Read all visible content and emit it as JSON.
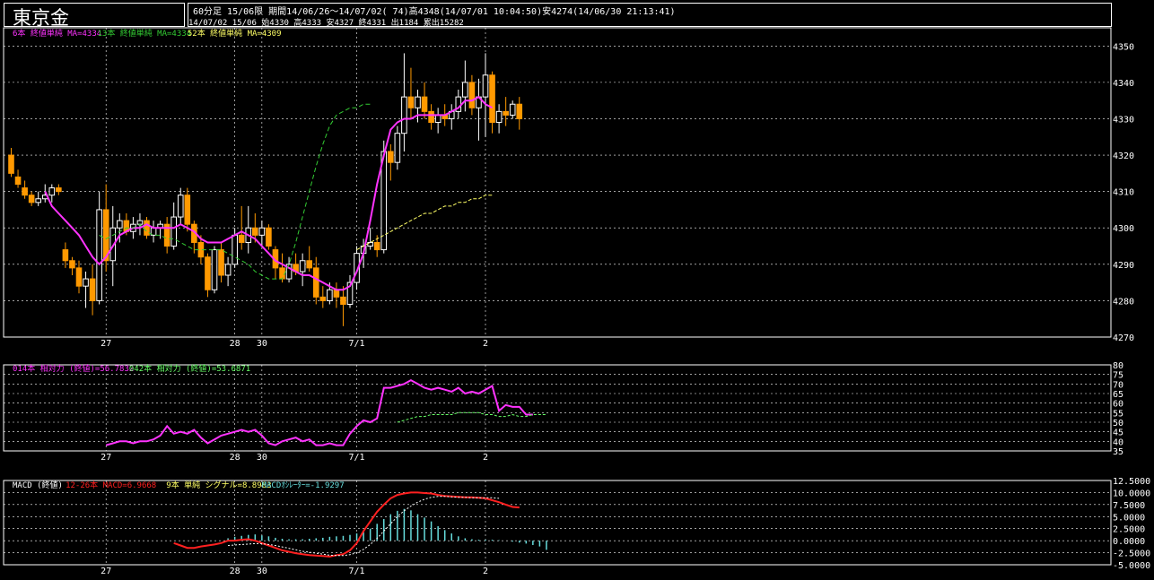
{
  "header": {
    "title": "東京金",
    "line1": "60分足 15/06限 期間14/06/26～14/07/02( 74)高4348(14/07/01 10:04:50)安4274(14/06/30 21:13:41)",
    "line2": "14/07/02 15/06 始4330 高4333 安4327 終4331 出1184 累出15282"
  },
  "colors": {
    "bg": "#000000",
    "grid": "#ffffff",
    "candle_up": "#ffffff",
    "candle_down": "#ff9900",
    "ma6": "#ff33ff",
    "ma13": "#33cc33",
    "ma52": "#ffff66",
    "rsi14": "#ff33ff",
    "rsi42": "#66ff66",
    "macd": "#ff2020",
    "signal": "#ffffff",
    "oscillator": "#66dddd"
  },
  "x_labels": [
    {
      "text": "27",
      "i": 14
    },
    {
      "text": "28",
      "i": 33
    },
    {
      "text": "30",
      "i": 37
    },
    {
      "text": "7/1",
      "i": 51
    },
    {
      "text": "2",
      "i": 70
    }
  ],
  "vlines_i": [
    14,
    33,
    37,
    51,
    70
  ],
  "price_legend": [
    {
      "text": "6本 終値単純 MA=4334",
      "color": "#ff33ff"
    },
    {
      "text": "13本 終値単純 MA=4334",
      "color": "#33cc33"
    },
    {
      "text": "52本 終値単純 MA=4309",
      "color": "#ffff66"
    }
  ],
  "rsi_legend": [
    {
      "text": "014本 相対力 (終値)=56.7832",
      "color": "#ff33ff"
    },
    {
      "text": "042本 相対力 (終値)=53.6871",
      "color": "#66ff66"
    }
  ],
  "macd_legend": [
    {
      "text": "MACD (終値)",
      "color": "#ffffff"
    },
    {
      "text": "12-26本 MACD=6.9668",
      "color": "#ff2020"
    },
    {
      "text": "9本 単純 シグナル=8.8963",
      "color": "#ffff66"
    },
    {
      "text": "MACDｵｼﾚｰﾀｰ=-1.9297",
      "color": "#66dddd"
    }
  ],
  "chart_data": [
    {
      "type": "candlestick",
      "name": "price",
      "ylim": [
        4270,
        4355
      ],
      "yticks": [
        4270,
        4280,
        4290,
        4300,
        4310,
        4320,
        4330,
        4340,
        4350
      ],
      "candles": [
        [
          4320,
          4322,
          4314,
          4315
        ],
        [
          4314,
          4316,
          4311,
          4312
        ],
        [
          4311,
          4313,
          4308,
          4309
        ],
        [
          4309,
          4310,
          4306,
          4307
        ],
        [
          4307,
          4310,
          4306,
          4308
        ],
        [
          4308,
          4312,
          4307,
          4309
        ],
        [
          4309,
          4312,
          4307,
          4311
        ],
        [
          4311,
          4312,
          4309,
          4310
        ],
        [
          4294,
          4296,
          4289,
          4291
        ],
        [
          4291,
          4292,
          4287,
          4289
        ],
        [
          4289,
          4291,
          4282,
          4284
        ],
        [
          4284,
          4288,
          4278,
          4286
        ],
        [
          4286,
          4290,
          4276,
          4280
        ],
        [
          4280,
          4310,
          4279,
          4305
        ],
        [
          4305,
          4312,
          4288,
          4291
        ],
        [
          4291,
          4306,
          4284,
          4300
        ],
        [
          4300,
          4304,
          4296,
          4302
        ],
        [
          4302,
          4304,
          4298,
          4299
        ],
        [
          4299,
          4303,
          4297,
          4301
        ],
        [
          4301,
          4304,
          4298,
          4302
        ],
        [
          4302,
          4303,
          4297,
          4298
        ],
        [
          4298,
          4302,
          4296,
          4300
        ],
        [
          4300,
          4302,
          4297,
          4301
        ],
        [
          4301,
          4303,
          4293,
          4295
        ],
        [
          4295,
          4307,
          4294,
          4303
        ],
        [
          4303,
          4311,
          4301,
          4309
        ],
        [
          4309,
          4311,
          4299,
          4301
        ],
        [
          4301,
          4302,
          4293,
          4296
        ],
        [
          4296,
          4298,
          4290,
          4292
        ],
        [
          4292,
          4293,
          4281,
          4283
        ],
        [
          4283,
          4295,
          4282,
          4294
        ],
        [
          4294,
          4296,
          4285,
          4287
        ],
        [
          4287,
          4292,
          4284,
          4290
        ],
        [
          4290,
          4300,
          4289,
          4298
        ],
        [
          4298,
          4306,
          4294,
          4296
        ],
        [
          4296,
          4306,
          4293,
          4300
        ],
        [
          4300,
          4304,
          4296,
          4298
        ],
        [
          4298,
          4302,
          4295,
          4300
        ],
        [
          4300,
          4301,
          4294,
          4295
        ],
        [
          4294,
          4295,
          4286,
          4289
        ],
        [
          4289,
          4293,
          4285,
          4286
        ],
        [
          4286,
          4292,
          4285,
          4290
        ],
        [
          4290,
          4293,
          4287,
          4288
        ],
        [
          4288,
          4293,
          4284,
          4291
        ],
        [
          4291,
          4295,
          4288,
          4289
        ],
        [
          4289,
          4292,
          4279,
          4281
        ],
        [
          4281,
          4284,
          4278,
          4280
        ],
        [
          4280,
          4285,
          4279,
          4283
        ],
        [
          4283,
          4285,
          4278,
          4281
        ],
        [
          4281,
          4284,
          4273,
          4279
        ],
        [
          4279,
          4287,
          4278,
          4285
        ],
        [
          4285,
          4295,
          4283,
          4293
        ],
        [
          4293,
          4297,
          4289,
          4295
        ],
        [
          4295,
          4300,
          4294,
          4296
        ],
        [
          4296,
          4298,
          4292,
          4294
        ],
        [
          4294,
          4324,
          4293,
          4321
        ],
        [
          4321,
          4323,
          4313,
          4318
        ],
        [
          4318,
          4328,
          4316,
          4326
        ],
        [
          4326,
          4348,
          4321,
          4336
        ],
        [
          4336,
          4344,
          4330,
          4333
        ],
        [
          4333,
          4338,
          4329,
          4336
        ],
        [
          4336,
          4340,
          4330,
          4332
        ],
        [
          4332,
          4334,
          4327,
          4329
        ],
        [
          4329,
          4333,
          4326,
          4331
        ],
        [
          4331,
          4334,
          4328,
          4330
        ],
        [
          4330,
          4334,
          4327,
          4332
        ],
        [
          4332,
          4338,
          4330,
          4336
        ],
        [
          4336,
          4346,
          4332,
          4340
        ],
        [
          4340,
          4342,
          4331,
          4333
        ],
        [
          4333,
          4341,
          4324,
          4336
        ],
        [
          4336,
          4348,
          4325,
          4342
        ],
        [
          4342,
          4343,
          4326,
          4329
        ],
        [
          4329,
          4334,
          4326,
          4332
        ],
        [
          4332,
          4336,
          4328,
          4331
        ],
        [
          4331,
          4335,
          4330,
          4334
        ],
        [
          4334,
          4336,
          4327,
          4330
        ]
      ],
      "series": [
        {
          "id": "ma6",
          "values": [
            null,
            null,
            null,
            null,
            null,
            4310,
            4306,
            4304,
            4302,
            4300,
            4298,
            4295,
            4292,
            4290,
            4292,
            4295,
            4298,
            4299,
            4300,
            4300,
            4301,
            4300,
            4300,
            4300,
            4300,
            4301,
            4300,
            4299,
            4297,
            4296,
            4296,
            4296,
            4297,
            4298,
            4299,
            4298,
            4297,
            4295,
            4293,
            4291,
            4290,
            4289,
            4288,
            4287,
            4287,
            4286,
            4285,
            4284,
            4283,
            4283,
            4284,
            4288,
            4293,
            4302,
            4312,
            4320,
            4327,
            4329,
            4330,
            4330,
            4331,
            4331,
            4331,
            4331,
            4331,
            4332,
            4333,
            4335,
            4335,
            4336,
            4334,
            4333
          ]
        },
        {
          "id": "ma13",
          "values": [
            null,
            null,
            null,
            null,
            null,
            null,
            null,
            null,
            null,
            null,
            null,
            null,
            null,
            4298,
            4297,
            4298,
            4299,
            4300,
            4300,
            4301,
            4299,
            4298,
            4298,
            4297,
            4297,
            4296,
            4295,
            4294,
            4294,
            4294,
            4294,
            4294,
            4293,
            4292,
            4291,
            4290,
            4288,
            4287,
            4286,
            4286,
            4286,
            4290,
            4296,
            4303,
            4310,
            4317,
            4323,
            4328,
            4331,
            4332,
            4333,
            4333,
            4334,
            4334
          ]
        },
        {
          "id": "ma52",
          "values": [
            null,
            null,
            null,
            null,
            null,
            null,
            null,
            null,
            null,
            null,
            null,
            null,
            null,
            null,
            null,
            null,
            null,
            null,
            null,
            null,
            null,
            null,
            null,
            null,
            null,
            null,
            null,
            null,
            null,
            null,
            null,
            null,
            null,
            null,
            null,
            null,
            null,
            null,
            null,
            null,
            null,
            null,
            null,
            null,
            null,
            null,
            null,
            null,
            null,
            null,
            null,
            4294,
            4295,
            4296,
            4297,
            4298,
            4299,
            4300,
            4301,
            4302,
            4303,
            4304,
            4304,
            4305,
            4306,
            4306,
            4307,
            4307,
            4308,
            4308,
            4309,
            4309
          ]
        }
      ]
    },
    {
      "type": "line",
      "name": "rsi",
      "ylim": [
        35,
        80
      ],
      "yticks": [
        35,
        40,
        45,
        50,
        55,
        60,
        65,
        70,
        75,
        80
      ],
      "series": [
        {
          "id": "rsi14",
          "values": [
            null,
            null,
            null,
            null,
            null,
            null,
            null,
            null,
            null,
            null,
            null,
            null,
            null,
            null,
            38,
            39,
            40,
            40,
            39,
            40,
            40,
            41,
            43,
            48,
            44,
            45,
            44,
            46,
            42,
            39,
            41,
            43,
            44,
            45,
            46,
            45,
            46,
            43,
            39,
            38,
            40,
            41,
            42,
            40,
            41,
            38,
            38,
            39,
            38,
            38,
            44,
            48,
            51,
            50,
            52,
            68,
            68,
            69,
            70,
            72,
            70,
            68,
            67,
            68,
            67,
            66,
            68,
            65,
            66,
            65,
            67,
            69,
            56,
            59,
            58,
            58,
            54,
            54
          ]
        },
        {
          "id": "rsi42",
          "values": [
            null,
            null,
            null,
            null,
            null,
            null,
            null,
            null,
            null,
            null,
            null,
            null,
            null,
            null,
            null,
            null,
            null,
            null,
            null,
            null,
            null,
            null,
            null,
            null,
            null,
            null,
            null,
            null,
            null,
            null,
            null,
            null,
            null,
            null,
            null,
            null,
            null,
            null,
            null,
            null,
            null,
            null,
            null,
            null,
            null,
            null,
            null,
            null,
            null,
            null,
            null,
            null,
            null,
            null,
            null,
            null,
            null,
            50,
            51,
            52,
            53,
            53,
            54,
            54,
            54,
            54,
            55,
            55,
            55,
            55,
            54,
            54,
            53,
            53,
            54,
            53,
            53,
            54,
            54,
            54
          ]
        }
      ]
    },
    {
      "type": "bar+line",
      "name": "macd",
      "ylim": [
        -5,
        12.5
      ],
      "yticks": [
        -5,
        -2.5,
        0,
        2.5,
        5,
        7.5,
        10,
        12.5
      ],
      "ytick_labels": [
        "-5.0000",
        "-2.5000",
        "0.0000",
        "2.5000",
        "5.0000",
        "7.5000",
        "10.0000",
        "12.5000"
      ],
      "oscillator": [
        null,
        null,
        null,
        null,
        null,
        null,
        null,
        null,
        null,
        null,
        null,
        null,
        null,
        null,
        null,
        null,
        null,
        null,
        null,
        null,
        null,
        null,
        null,
        null,
        null,
        null,
        null,
        null,
        null,
        null,
        null,
        null,
        0.5,
        0.8,
        1.0,
        1.2,
        1.3,
        1.1,
        0.9,
        0.6,
        0.4,
        0.3,
        0.3,
        0.3,
        0.4,
        0.5,
        0.6,
        0.8,
        0.9,
        1.0,
        1.2,
        1.5,
        1.8,
        2.5,
        3.5,
        4.5,
        5.5,
        6.2,
        6.6,
        6.3,
        5.5,
        4.8,
        4.0,
        3.0,
        2.2,
        1.5,
        0.9,
        0.5,
        0.3,
        0.2,
        0.2,
        0.2,
        0.1,
        0.0,
        -0.2,
        -0.4,
        -0.6,
        -0.9,
        -1.2,
        -1.9
      ],
      "series": [
        {
          "id": "macd",
          "values": [
            null,
            null,
            null,
            null,
            null,
            null,
            null,
            null,
            null,
            null,
            null,
            null,
            null,
            null,
            null,
            null,
            null,
            null,
            null,
            null,
            null,
            null,
            null,
            null,
            -0.5,
            -1.0,
            -1.5,
            -1.5,
            -1.2,
            -1.0,
            -0.8,
            -0.5,
            0.0,
            0.0,
            0.2,
            0.3,
            0.0,
            -0.5,
            -1.0,
            -1.5,
            -2.0,
            -2.3,
            -2.6,
            -2.8,
            -3.0,
            -3.1,
            -3.2,
            -3.3,
            -3.0,
            -2.8,
            -2.0,
            -0.5,
            2.0,
            4.0,
            6.0,
            7.5,
            8.8,
            9.5,
            9.8,
            10.0,
            10.0,
            9.9,
            9.8,
            9.5,
            9.3,
            9.2,
            9.1,
            9.0,
            9.0,
            8.9,
            8.8,
            8.4,
            8.0,
            7.5,
            7.0,
            6.9
          ]
        },
        {
          "id": "signal",
          "values": [
            null,
            null,
            null,
            null,
            null,
            null,
            null,
            null,
            null,
            null,
            null,
            null,
            null,
            null,
            null,
            null,
            null,
            null,
            null,
            null,
            null,
            null,
            null,
            null,
            null,
            null,
            null,
            null,
            null,
            null,
            null,
            null,
            -1.0,
            -0.9,
            -0.8,
            -0.7,
            -0.6,
            -0.6,
            -0.8,
            -1.0,
            -1.3,
            -1.6,
            -1.9,
            -2.2,
            -2.4,
            -2.6,
            -2.8,
            -3.0,
            -3.1,
            -3.1,
            -2.9,
            -2.5,
            -1.8,
            -0.8,
            0.5,
            2.0,
            3.5,
            5.0,
            6.2,
            7.2,
            8.0,
            8.6,
            9.0,
            9.2,
            9.2,
            9.1,
            9.0,
            9.0,
            8.9,
            8.9,
            8.9,
            8.9,
            8.8
          ]
        }
      ]
    }
  ]
}
